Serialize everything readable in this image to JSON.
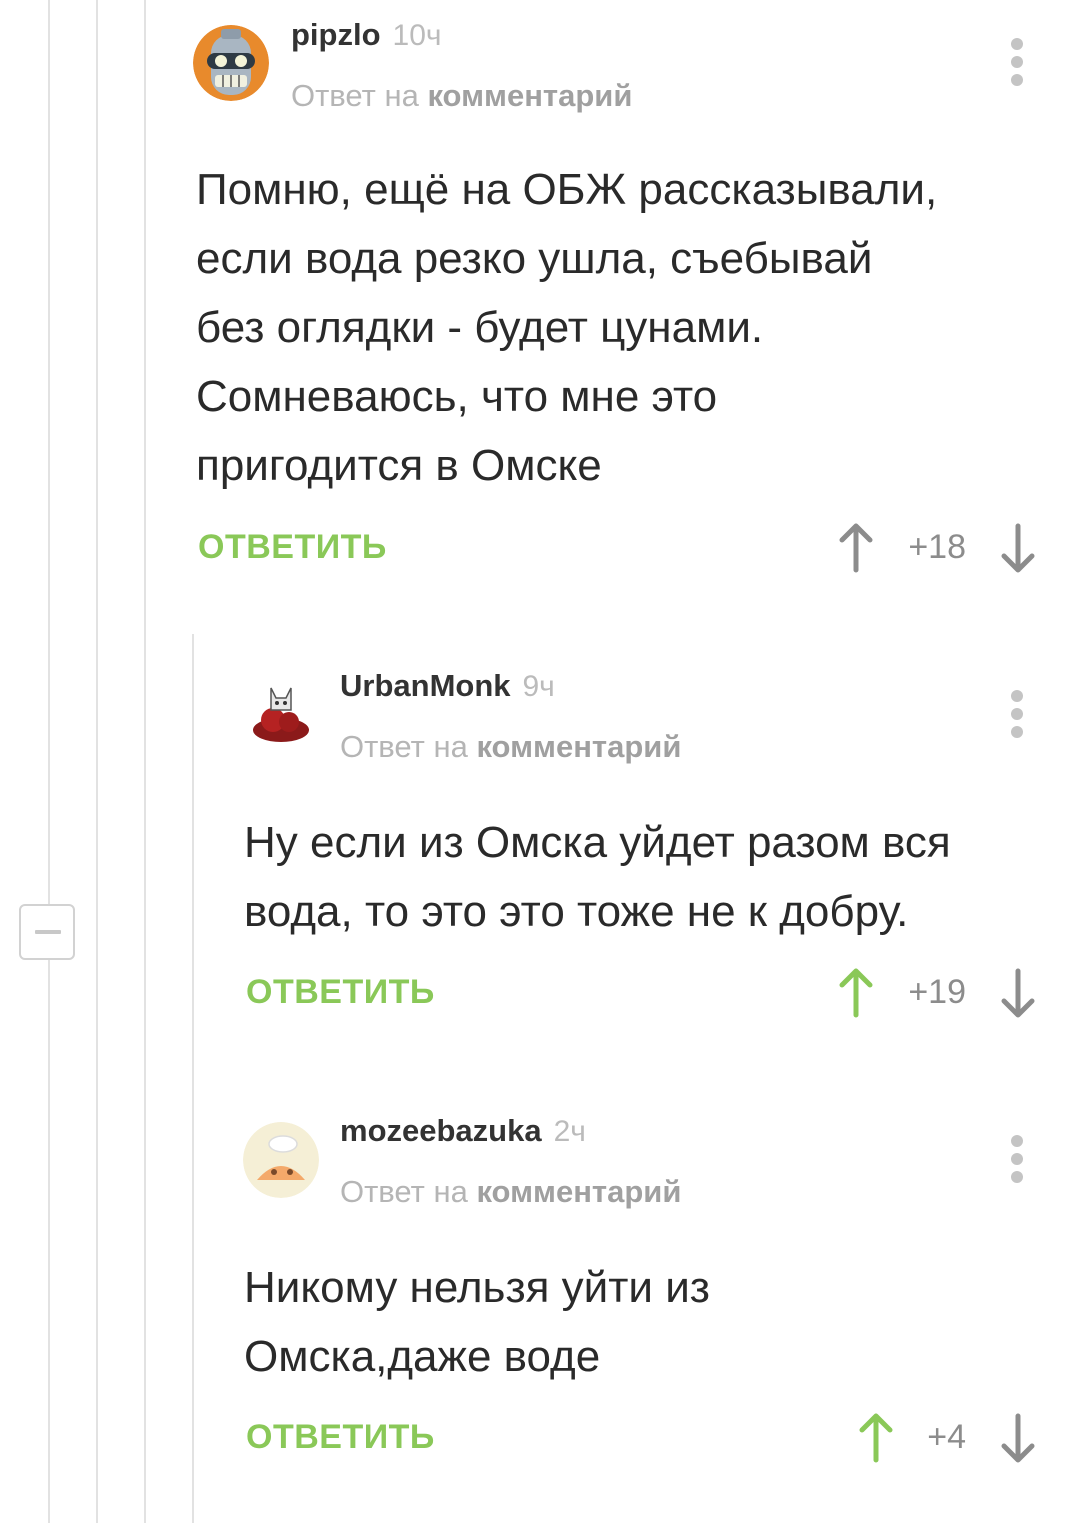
{
  "thread": {
    "collapse_icon": "minus-icon"
  },
  "comments": [
    {
      "author": "pipzlo",
      "time": "10ч",
      "reply_to_prefix": "Ответ на",
      "reply_to_link": "комментарий",
      "text": "Помню, ещё на ОБЖ рассказывали,\nесли вода резко ушла, съебывай\nбез оглядки - будет цунами.\nСомневаюсь, что мне это\nпригодится в Омске",
      "reply_label": "ОТВЕТИТЬ",
      "score": "+18",
      "upvoted": false
    },
    {
      "author": "UrbanMonk",
      "time": "9ч",
      "reply_to_prefix": "Ответ на",
      "reply_to_link": "комментарий",
      "text": "Ну если из Омска уйдет разом вся\nвода, то это это тоже не к добру.",
      "reply_label": "ОТВЕТИТЬ",
      "score": "+19",
      "upvoted": true
    },
    {
      "author": "mozeebazuka",
      "time": "2ч",
      "reply_to_prefix": "Ответ на",
      "reply_to_link": "комментарий",
      "text": "Никому нельзя уйти из\nОмска,даже воде",
      "reply_label": "ОТВЕТИТЬ",
      "score": "+4",
      "upvoted": true
    }
  ],
  "colors": {
    "accent_green": "#8ac858",
    "muted_gray": "#b5b5b5"
  }
}
